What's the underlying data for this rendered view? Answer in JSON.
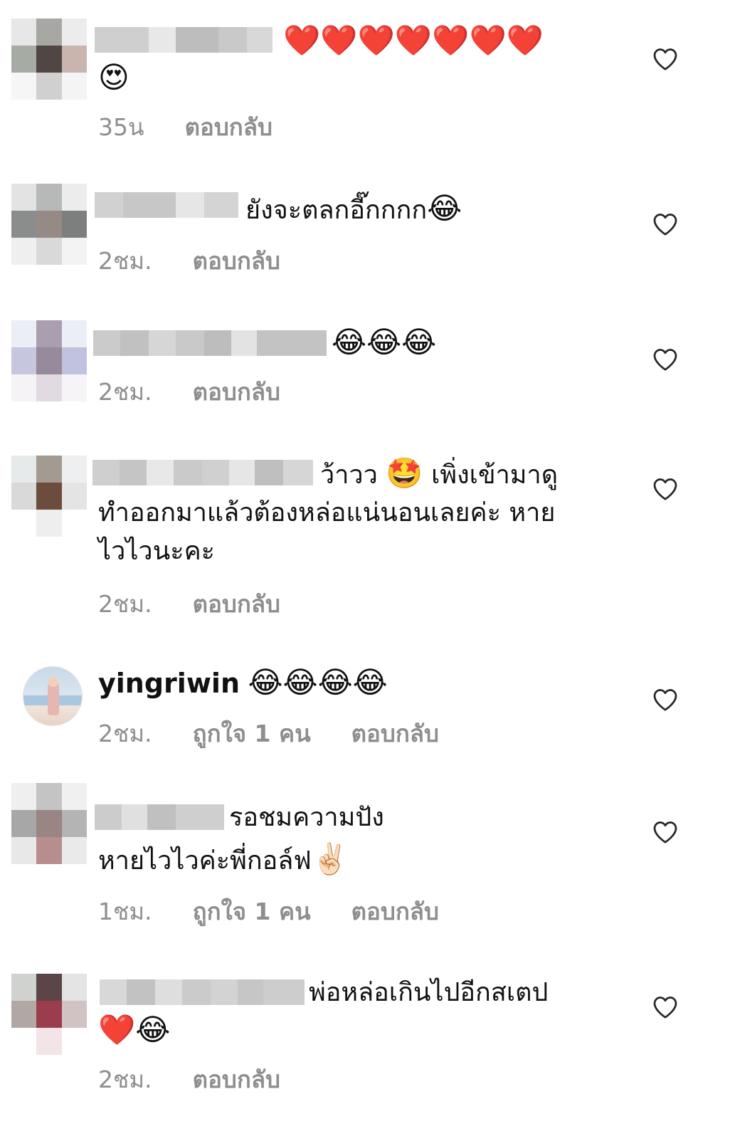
{
  "comments": [
    {
      "username": "",
      "text": "",
      "emojis_line1": "❤️❤️❤️❤️❤️❤️❤️",
      "emojis_line2": "😍",
      "time": "35น",
      "likes": "",
      "reply": "ตอบกลับ"
    },
    {
      "username": "",
      "text": "ยังจะตลกอี๊กกกก",
      "emojis": "😂",
      "time": "2ชม.",
      "likes": "",
      "reply": "ตอบกลับ"
    },
    {
      "username": "",
      "text": "",
      "emojis": "😂😂😂",
      "time": "2ชม.",
      "likes": "",
      "reply": "ตอบกลับ"
    },
    {
      "username": "",
      "text_line1": "ว้าวว",
      "emoji_mid": "🤩",
      "text_line1b": "เพิ่งเข้ามาดู",
      "text_line2": "ทำออกมาแล้วต้องหล่อแน่นอนเลยค่ะ  หาย",
      "text_line3": "ไวไวนะคะ",
      "time": "2ชม.",
      "likes": "",
      "reply": "ตอบกลับ"
    },
    {
      "username": "yingriwin",
      "emojis": "😂😂😂😂",
      "time": "2ชม.",
      "likes": "ถูกใจ 1 คน",
      "reply": "ตอบกลับ"
    },
    {
      "username": "",
      "text_line1": "รอชมความปัง",
      "text_line2": "หายไวไวค่ะพี่กอล์ฟ",
      "emoji_end": "✌🏻",
      "time": "1ชม.",
      "likes": "ถูกใจ 1 คน",
      "reply": "ตอบกลับ"
    },
    {
      "username": "",
      "text_line1": "พ่อหล่อเกินไปอีกสเตป",
      "emojis_line2": "❤️😂",
      "time": "2ชม.",
      "likes": "",
      "reply": "ตอบกลับ"
    }
  ],
  "icons": {
    "like": "heart-outline-icon"
  },
  "colors": {
    "meta": "#8e8e8e",
    "text": "#111111",
    "heart_stroke": "#262626"
  }
}
